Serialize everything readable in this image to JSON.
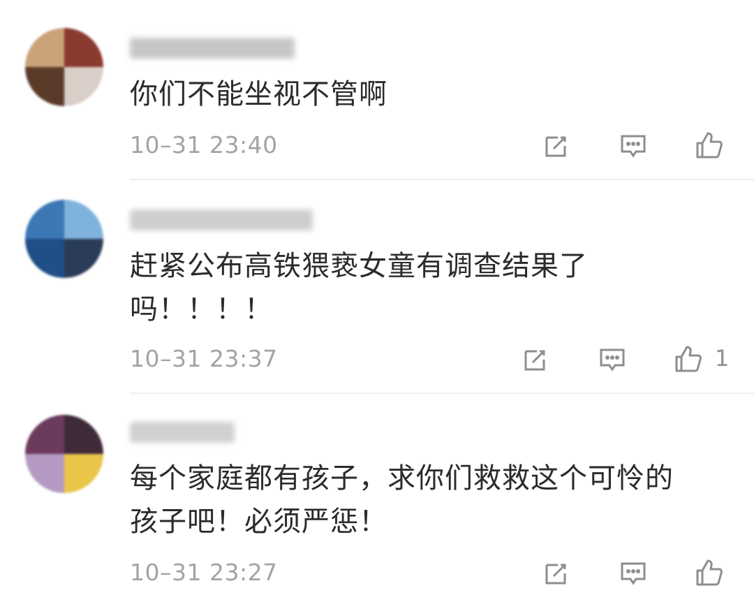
{
  "comments": [
    {
      "text": "你们不能坐视不管啊",
      "time": "10–31 23:40",
      "likes": "",
      "avatar_colors": [
        "#8a3a2e",
        "#c9a27a",
        "#5a3b2a",
        "#d9cfc8"
      ],
      "username_color": "#bdbdbd"
    },
    {
      "text_line1": "赶紧公布高铁猥亵女童有调查结果了",
      "text_line2": "吗！！！！",
      "time": "10–31 23:37",
      "likes": "1",
      "avatar_colors": [
        "#3b78b5",
        "#1f4f86",
        "#7fb2dd",
        "#2a3c58"
      ],
      "username_color": "#c6c6c6"
    },
    {
      "text_line1": "每个家庭都有孩子，求你们救救这个可怜的",
      "text_line2": "孩子吧！必须严惩！",
      "time": "10–31 23:27",
      "likes": "",
      "avatar_colors": [
        "#6b3a5c",
        "#b49ac2",
        "#3f2a3a",
        "#e9c54a"
      ],
      "username_color": "#c8c8c8"
    }
  ],
  "icons": {
    "reply": "edit-square-icon",
    "comment": "comment-bubble-icon",
    "like": "thumbs-up-icon"
  },
  "colors": {
    "text": "#2b2b2b",
    "meta": "#a3a3a3",
    "icon": "#8e8e8e",
    "divider": "#efefef"
  }
}
